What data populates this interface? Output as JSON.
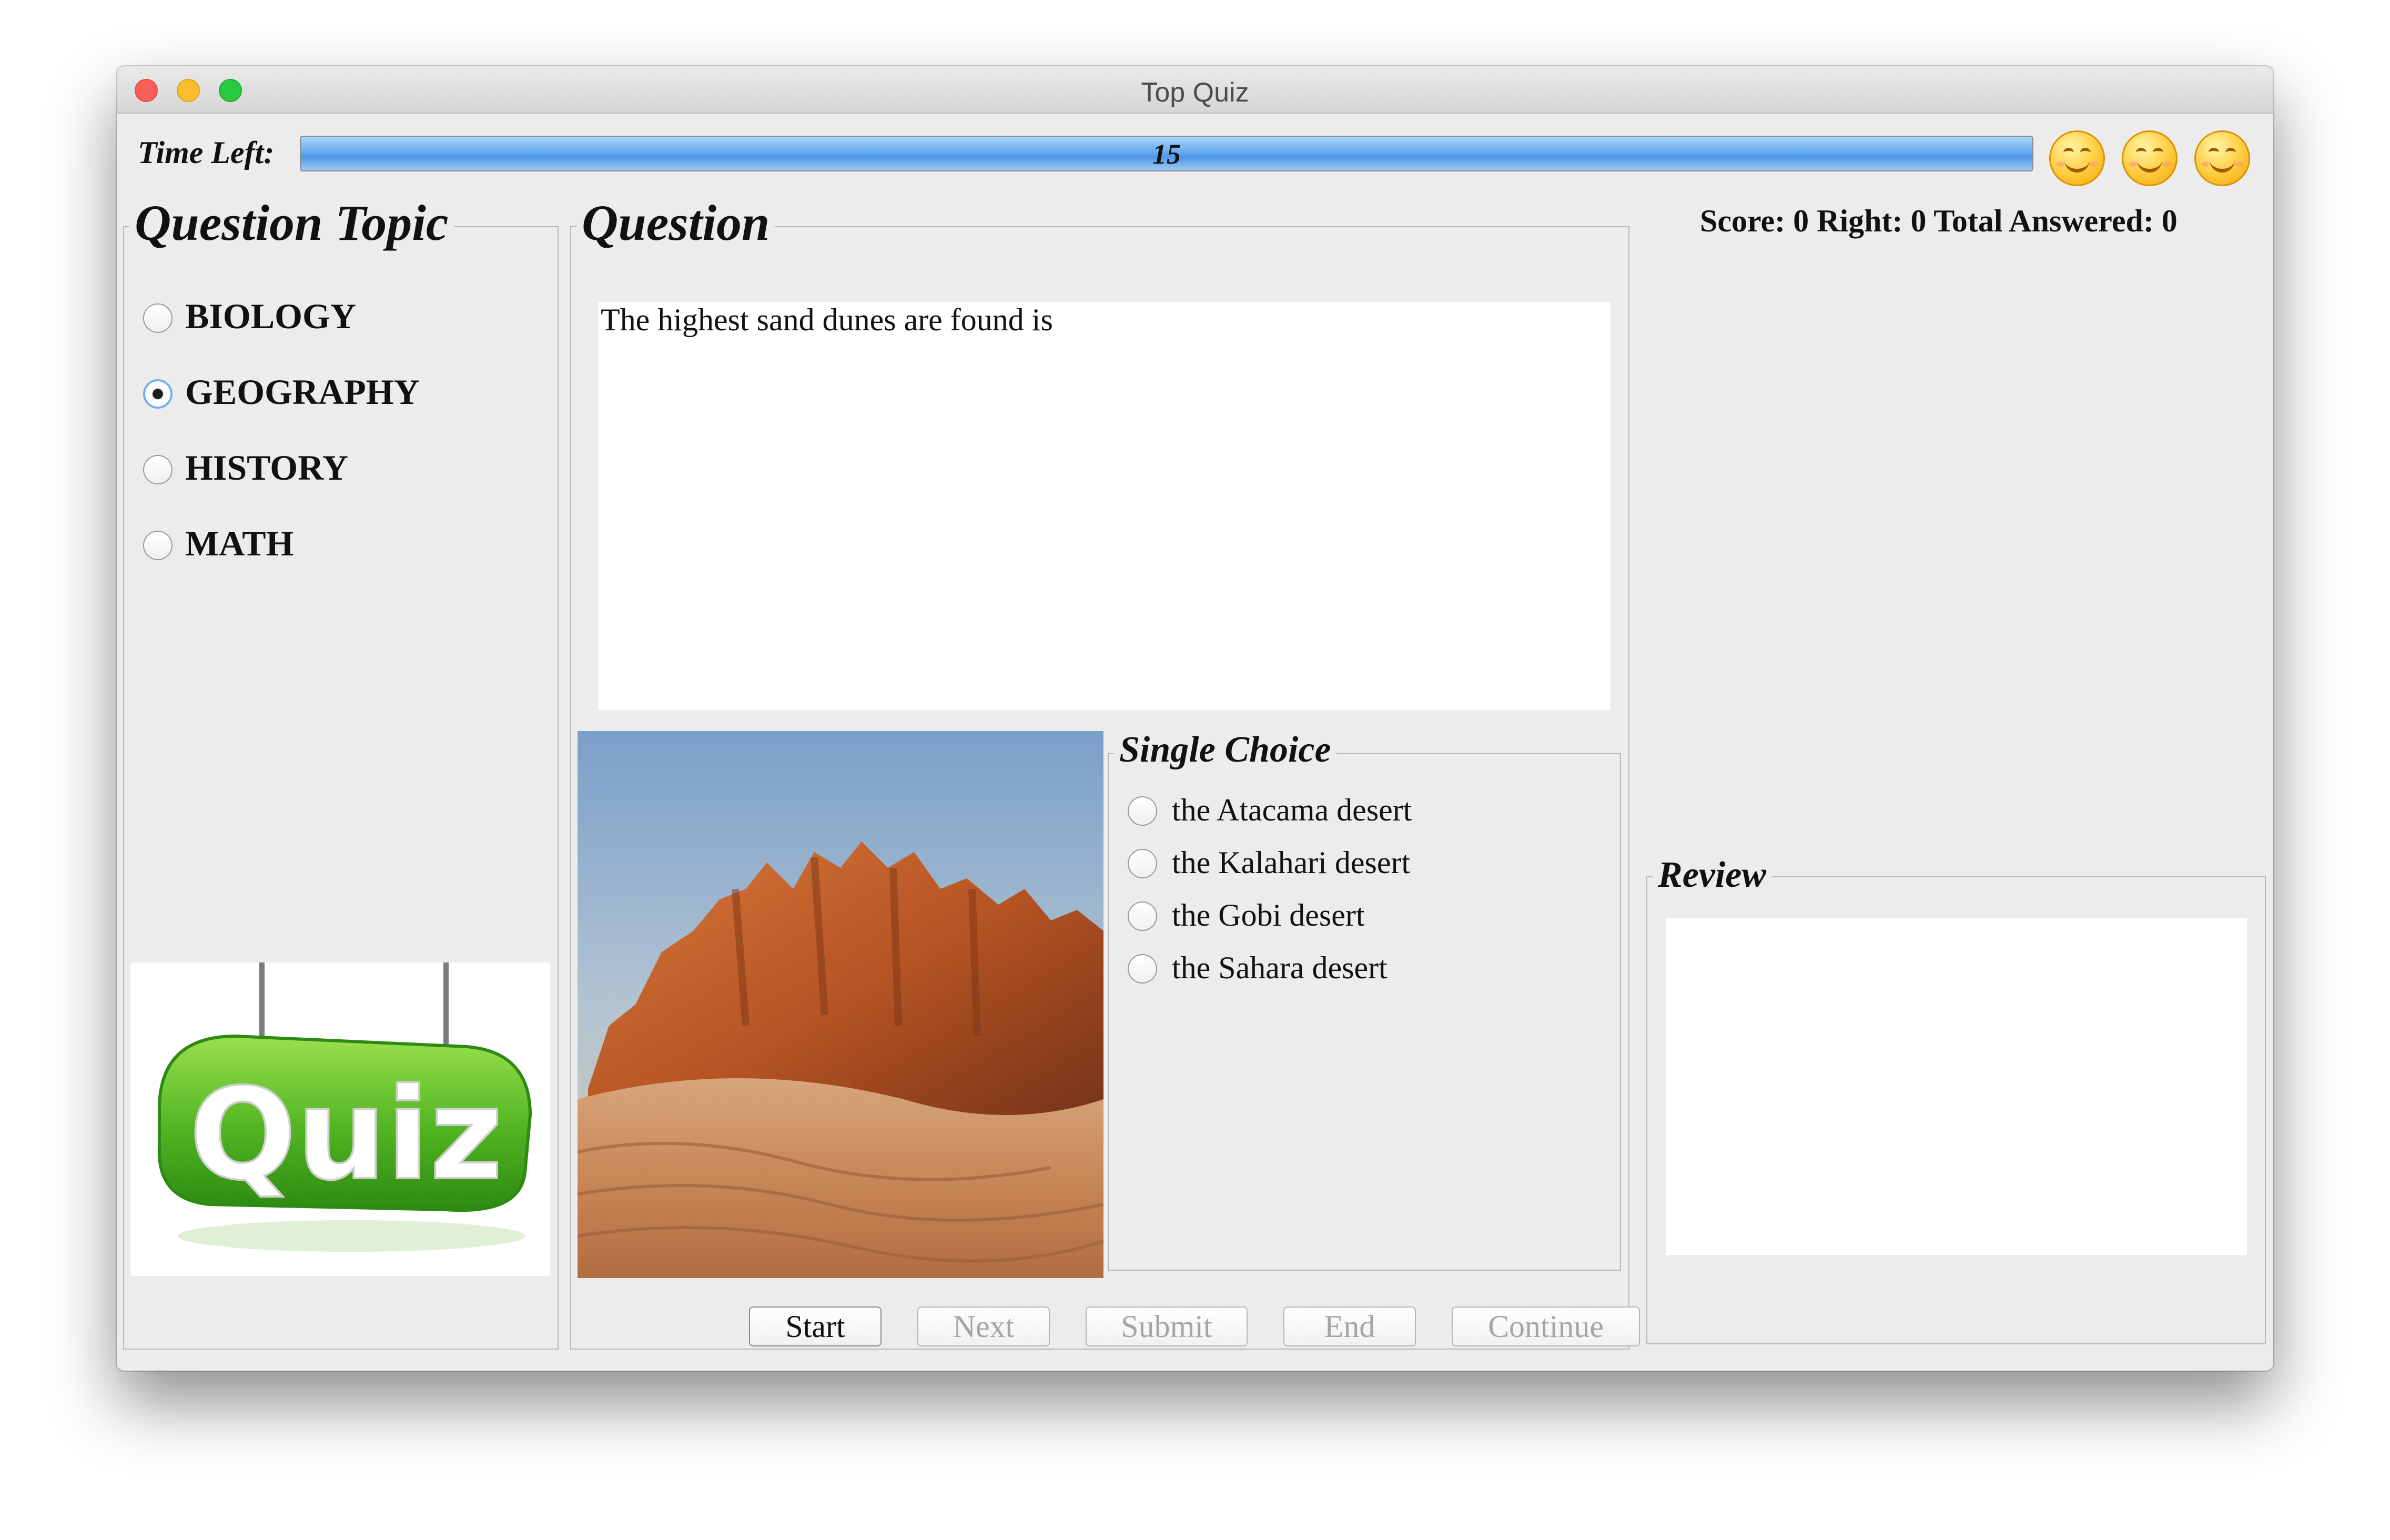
{
  "window": {
    "title": "Top Quiz"
  },
  "timer": {
    "label": "Time Left:",
    "value": "15",
    "progress_fraction": 1.0
  },
  "smileys": [
    "smiley-icon",
    "smiley-icon",
    "smiley-icon"
  ],
  "topics": {
    "title": "Question Topic",
    "items": [
      {
        "label": "BIOLOGY",
        "selected": false
      },
      {
        "label": "GEOGRAPHY",
        "selected": true
      },
      {
        "label": "HISTORY",
        "selected": false
      },
      {
        "label": "MATH",
        "selected": false
      }
    ],
    "logo_text": "Quiz"
  },
  "question": {
    "title": "Question",
    "text": "The highest sand dunes are found is",
    "image": "desert-image"
  },
  "choices": {
    "title": "Single Choice",
    "items": [
      {
        "label": "the Atacama desert",
        "selected": false
      },
      {
        "label": "the Kalahari desert",
        "selected": false
      },
      {
        "label": "the Gobi desert",
        "selected": false
      },
      {
        "label": "the Sahara desert",
        "selected": false
      }
    ]
  },
  "score_text": "Score: 0 Right: 0 Total Answered: 0",
  "review": {
    "title": "Review",
    "text": ""
  },
  "buttons": [
    {
      "label": "Start",
      "enabled": true
    },
    {
      "label": "Next",
      "enabled": false
    },
    {
      "label": "Submit",
      "enabled": false
    },
    {
      "label": "End",
      "enabled": false
    },
    {
      "label": "Continue",
      "enabled": false
    }
  ],
  "colors": {
    "accent": "#4f97e8",
    "window_bg": "#ececec",
    "progress": "#6fb1f3"
  }
}
